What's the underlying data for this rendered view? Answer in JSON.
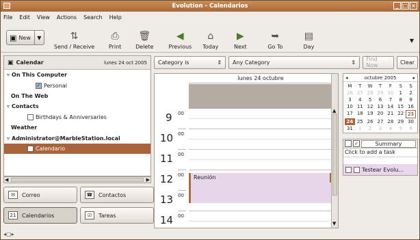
{
  "window": {
    "title": "Evolution - Calendarios"
  },
  "menu": [
    "File",
    "Edit",
    "View",
    "Actions",
    "Search",
    "Help"
  ],
  "toolbar": {
    "new": "New",
    "send_receive": "Send / Receive",
    "print": "Print",
    "delete": "Delete",
    "previous": "Previous",
    "today": "Today",
    "next": "Next",
    "goto": "Go To",
    "day": "Day"
  },
  "sidebar": {
    "title": "Calendar",
    "date": "lunes 24 oct 2005",
    "tree": [
      {
        "label": "On This Computer",
        "type": "group"
      },
      {
        "label": "Personal",
        "type": "item",
        "checked": true
      },
      {
        "label": "On The Web",
        "type": "group"
      },
      {
        "label": "Contacts",
        "type": "group"
      },
      {
        "label": "Birthdays & Anniversaries",
        "type": "item",
        "checked": false
      },
      {
        "label": "Weather",
        "type": "group"
      },
      {
        "label": "Administrator@MarbleStation.local",
        "type": "group"
      },
      {
        "label": "Calendario",
        "type": "item",
        "checked": true,
        "selected": true
      }
    ]
  },
  "switcher": {
    "mail": "Correo",
    "contacts": "Contactos",
    "calendars": "Calendarios",
    "tasks": "Tareas"
  },
  "filter": {
    "field": "Category is",
    "value": "Any Category",
    "find": "Find Now",
    "clear": "Clear"
  },
  "calendar": {
    "day_header": "lunes 24 octubre",
    "hours": [
      "9",
      "10",
      "11",
      "12",
      "13",
      "14"
    ],
    "minutes": "00",
    "event": "Reunión"
  },
  "mini": {
    "month": "octubre 2005",
    "weekdays": [
      "M",
      "T",
      "W",
      "T",
      "F",
      "S",
      "S"
    ],
    "days": [
      "26",
      "27",
      "28",
      "29",
      "30",
      "1",
      "2",
      "3",
      "4",
      "5",
      "6",
      "7",
      "8",
      "9",
      "10",
      "11",
      "12",
      "13",
      "14",
      "15",
      "16",
      "17",
      "18",
      "19",
      "20",
      "21",
      "22",
      "23",
      "24",
      "25",
      "26",
      "27",
      "28",
      "29",
      "30",
      "31",
      "1",
      "2",
      "3",
      "4",
      "5",
      "6"
    ]
  },
  "tasks": {
    "summary": "Summary",
    "add": "Click to add a task",
    "item": "Testear Evolu..."
  }
}
